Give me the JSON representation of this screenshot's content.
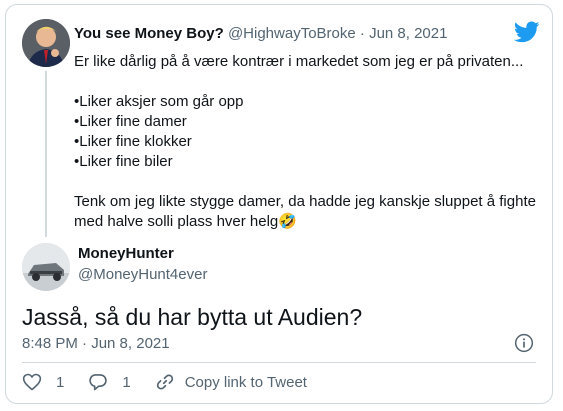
{
  "parent_tweet": {
    "display_name": "You see Money Boy?",
    "handle": "@HighwayToBroke",
    "separator": "·",
    "date": "Jun 8, 2021",
    "line1": "Er like dårlig på å være kontrær i markedet som jeg er på privaten...",
    "bullets": [
      "•Liker aksjer som går opp",
      "•Liker fine damer",
      "•Liker fine klokker",
      "•Liker fine biler"
    ],
    "closing": "Tenk om jeg likte stygge damer, da hadde jeg kanskje sluppet å fighte med halve solli plass hver helg",
    "emoji": "🤣"
  },
  "reply_tweet": {
    "display_name": "MoneyHunter",
    "handle": "@MoneyHunt4ever",
    "text": "Jasså, så du har bytta ut Audien?",
    "timestamp": "8:48 PM · Jun 8, 2021"
  },
  "actions": {
    "like_count": "1",
    "reply_count": "1",
    "copy_link_label": "Copy link to Tweet"
  },
  "icons": {
    "brand": "twitter-bird-icon",
    "info": "info-icon",
    "like": "heart-icon",
    "reply": "reply-bubble-icon",
    "copy": "link-icon"
  },
  "colors": {
    "brand_blue": "#1d9bf0",
    "text_primary": "#0f1419",
    "text_secondary": "#536471",
    "border": "#cfd9de"
  }
}
